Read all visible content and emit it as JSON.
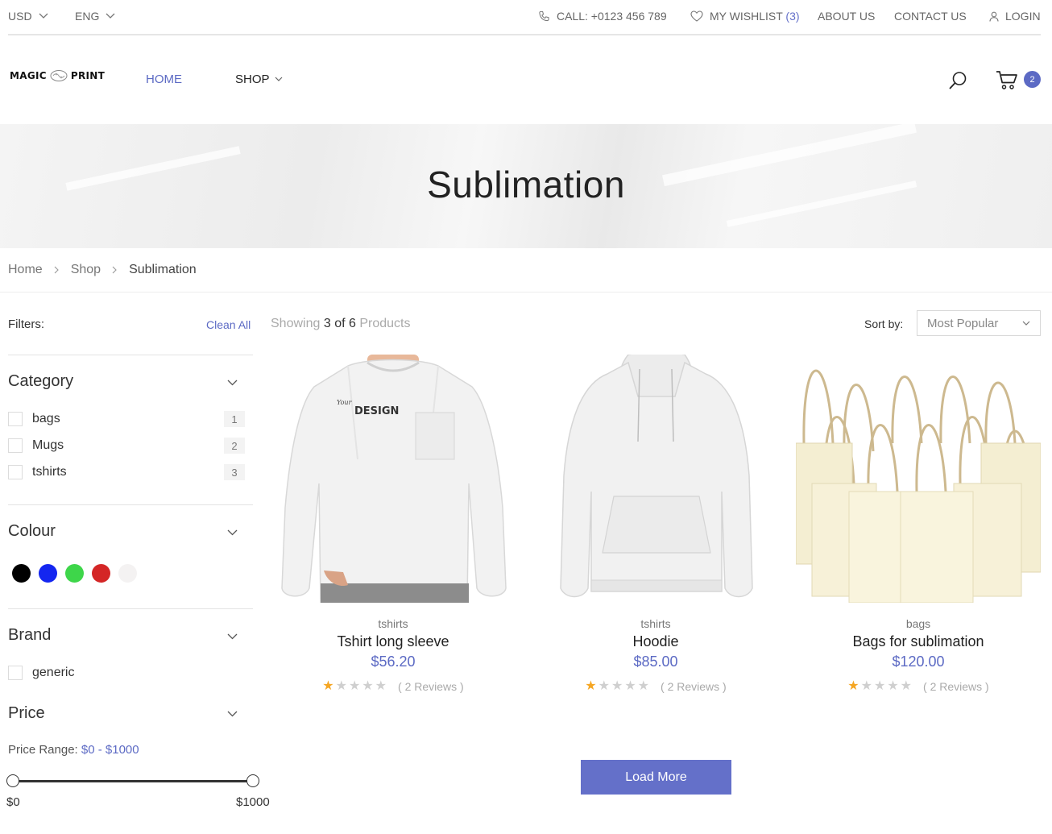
{
  "topbar": {
    "currency": "USD",
    "language": "ENG",
    "call": "CALL: +0123 456 789",
    "wishlist_label": "MY WISHLIST",
    "wishlist_count": "(3)",
    "about": "ABOUT US",
    "contact": "CONTACT US",
    "login": "LOGIN"
  },
  "header": {
    "logo_left": "MAGIC",
    "logo_right": "PRINT",
    "nav": [
      {
        "label": "HOME",
        "active": true
      },
      {
        "label": "SHOP",
        "active": false
      }
    ],
    "cart_count": "2"
  },
  "hero": {
    "title": "Sublimation"
  },
  "breadcrumb": [
    "Home",
    "Shop",
    "Sublimation"
  ],
  "sidebar": {
    "filters_label": "Filters:",
    "clean_all": "Clean All",
    "category": {
      "heading": "Category",
      "items": [
        {
          "label": "bags",
          "count": "1"
        },
        {
          "label": "Mugs",
          "count": "2"
        },
        {
          "label": "tshirts",
          "count": "3"
        }
      ]
    },
    "colour": {
      "heading": "Colour",
      "swatches": [
        "#000000",
        "#1426f0",
        "#3ed64a",
        "#d42626",
        "#f4f2f2"
      ]
    },
    "brand": {
      "heading": "Brand",
      "items": [
        {
          "label": "generic"
        }
      ]
    },
    "price": {
      "heading": "Price",
      "range_label": "Price Range:",
      "range_value": "$0 - $1000",
      "min": "$0",
      "max": "$1000",
      "selected_low_fraction": 0,
      "selected_high_fraction": 1
    }
  },
  "results": {
    "showing_word": "Showing",
    "shown": "3",
    "of_word": "of",
    "total": "6",
    "products_word": "Products",
    "sort_label": "Sort by:",
    "sort_value": "Most Popular"
  },
  "products": [
    {
      "category": "tshirts",
      "name": "Tshirt long sleeve",
      "price": "$56.20",
      "rating": 1,
      "reviews": "( 2 Reviews )",
      "print_text": "DESIGN"
    },
    {
      "category": "tshirts",
      "name": "Hoodie",
      "price": "$85.00",
      "rating": 1,
      "reviews": "( 2 Reviews )"
    },
    {
      "category": "bags",
      "name": "Bags for sublimation",
      "price": "$120.00",
      "rating": 1,
      "reviews": "( 2 Reviews )"
    }
  ],
  "load_more": "Load More",
  "colors": {
    "accent": "#5c6ac4",
    "button": "#6470c9",
    "star": "#f5a623"
  }
}
